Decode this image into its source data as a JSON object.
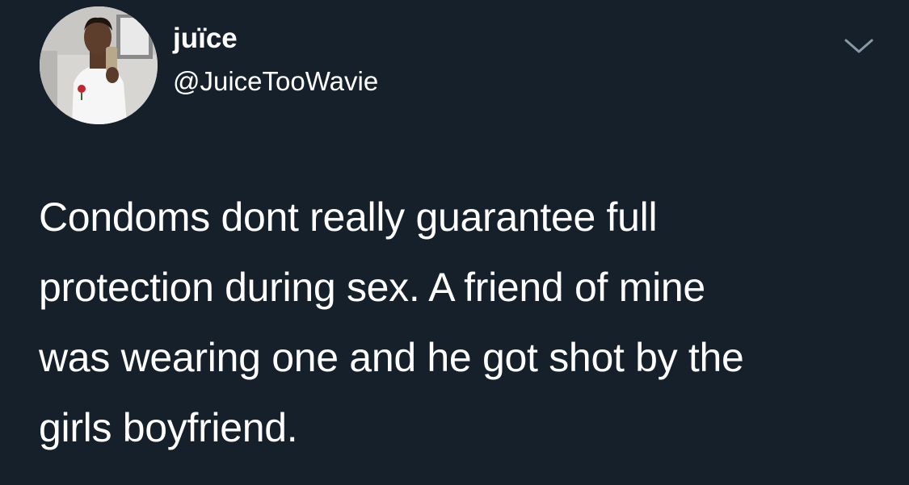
{
  "author": {
    "display_name": "juïce",
    "handle": "@JuiceTooWavie"
  },
  "tweet": {
    "lines": [
      "Condoms dont really guarantee full",
      "protection during sex. A friend of mine",
      "was wearing one and he got shot by the",
      "girls boyfriend."
    ]
  },
  "icons": {
    "menu": "chevron-down-icon"
  },
  "colors": {
    "background": "#15202b",
    "text": "#ffffff",
    "chevron": "#8899a6"
  }
}
